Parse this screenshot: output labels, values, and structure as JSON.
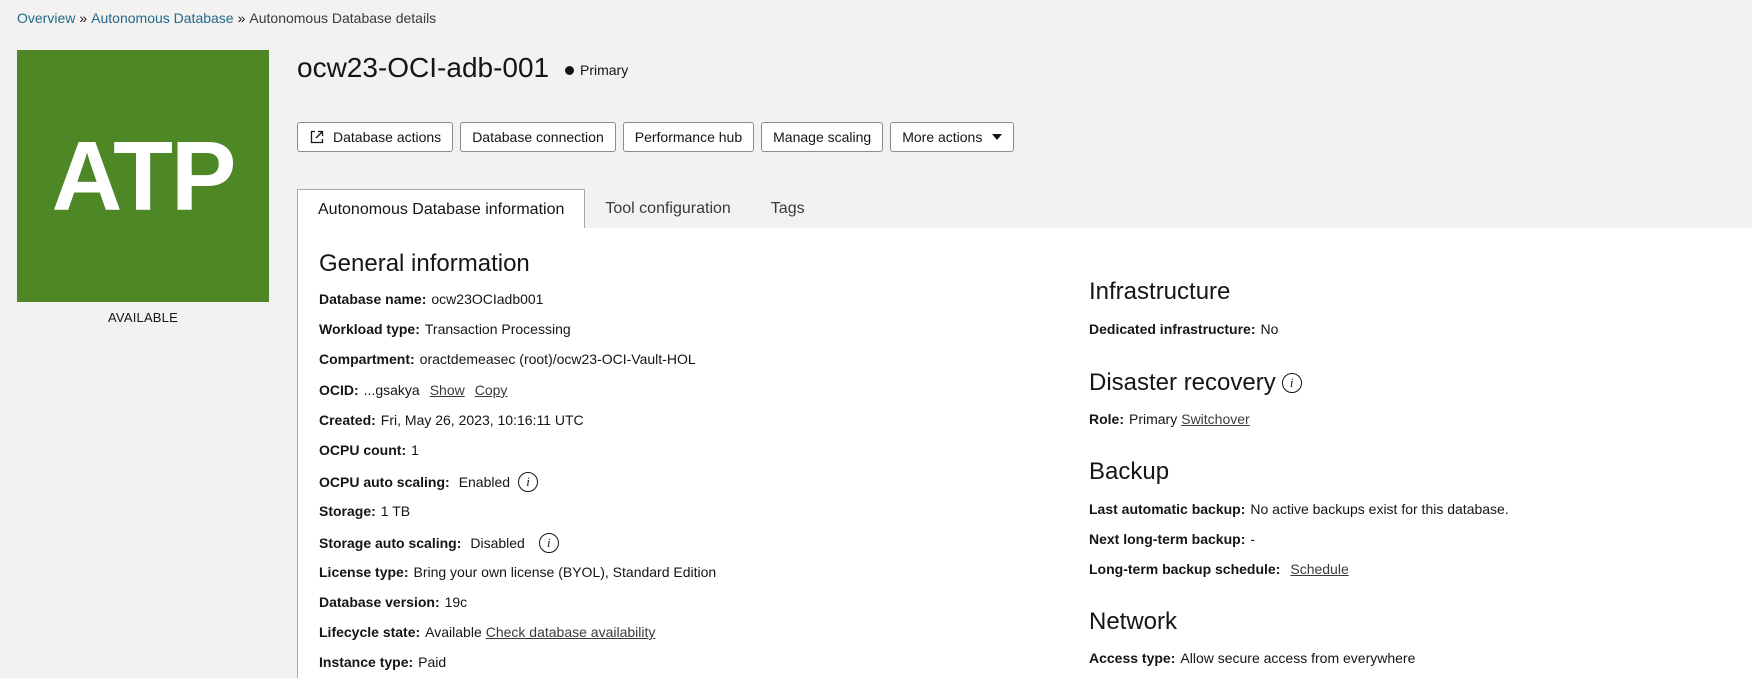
{
  "breadcrumb": {
    "items": [
      "Overview",
      "Autonomous Database"
    ],
    "separator": "»",
    "current": "Autonomous Database details"
  },
  "logo": {
    "text": "ATP",
    "color": "#4e8726",
    "status": "AVAILABLE"
  },
  "header": {
    "title": "ocw23-OCI-adb-001",
    "role": "Primary"
  },
  "actions": {
    "database_actions": "Database actions",
    "database_connection": "Database connection",
    "performance_hub": "Performance hub",
    "manage_scaling": "Manage scaling",
    "more_actions": "More actions"
  },
  "tabs": [
    "Autonomous Database information",
    "Tool configuration",
    "Tags"
  ],
  "general": {
    "title": "General information",
    "database_name": {
      "key": "Database name:",
      "value": "ocw23OCIadb001"
    },
    "workload_type": {
      "key": "Workload type:",
      "value": "Transaction Processing"
    },
    "compartment": {
      "key": "Compartment:",
      "value": "oractdemeasec (root)/ocw23-OCI-Vault-HOL"
    },
    "ocid": {
      "key": "OCID:",
      "value": "...gsakya",
      "show": "Show",
      "copy": "Copy"
    },
    "created": {
      "key": "Created:",
      "value": "Fri, May 26, 2023, 10:16:11 UTC"
    },
    "ocpu_count": {
      "key": "OCPU count:",
      "value": "1"
    },
    "ocpu_auto_scaling": {
      "key": "OCPU auto scaling:",
      "value": "Enabled"
    },
    "storage": {
      "key": "Storage:",
      "value": "1 TB"
    },
    "storage_auto_scaling": {
      "key": "Storage auto scaling:",
      "value": "Disabled"
    },
    "license_type": {
      "key": "License type:",
      "value": "Bring your own license (BYOL), Standard Edition"
    },
    "database_version": {
      "key": "Database version:",
      "value": "19c"
    },
    "lifecycle_state": {
      "key": "Lifecycle state:",
      "value": "Available",
      "link": "Check database availability"
    },
    "instance_type": {
      "key": "Instance type:",
      "value": "Paid"
    }
  },
  "infrastructure": {
    "title": "Infrastructure",
    "dedicated": {
      "key": "Dedicated infrastructure:",
      "value": "No"
    }
  },
  "disaster_recovery": {
    "title": "Disaster recovery",
    "role": {
      "key": "Role:",
      "value": "Primary",
      "link": "Switchover"
    }
  },
  "backup": {
    "title": "Backup",
    "last_auto": {
      "key": "Last automatic backup:",
      "value": "No active backups exist for this database."
    },
    "next_long_term": {
      "key": "Next long-term backup:",
      "value": "-"
    },
    "long_term_schedule": {
      "key": "Long-term backup schedule:",
      "link": "Schedule"
    }
  },
  "network": {
    "title": "Network",
    "access_type": {
      "key": "Access type:",
      "value": "Allow secure access from everywhere"
    }
  },
  "icons": [
    "external-link-icon",
    "caret-down-icon",
    "info-icon"
  ]
}
